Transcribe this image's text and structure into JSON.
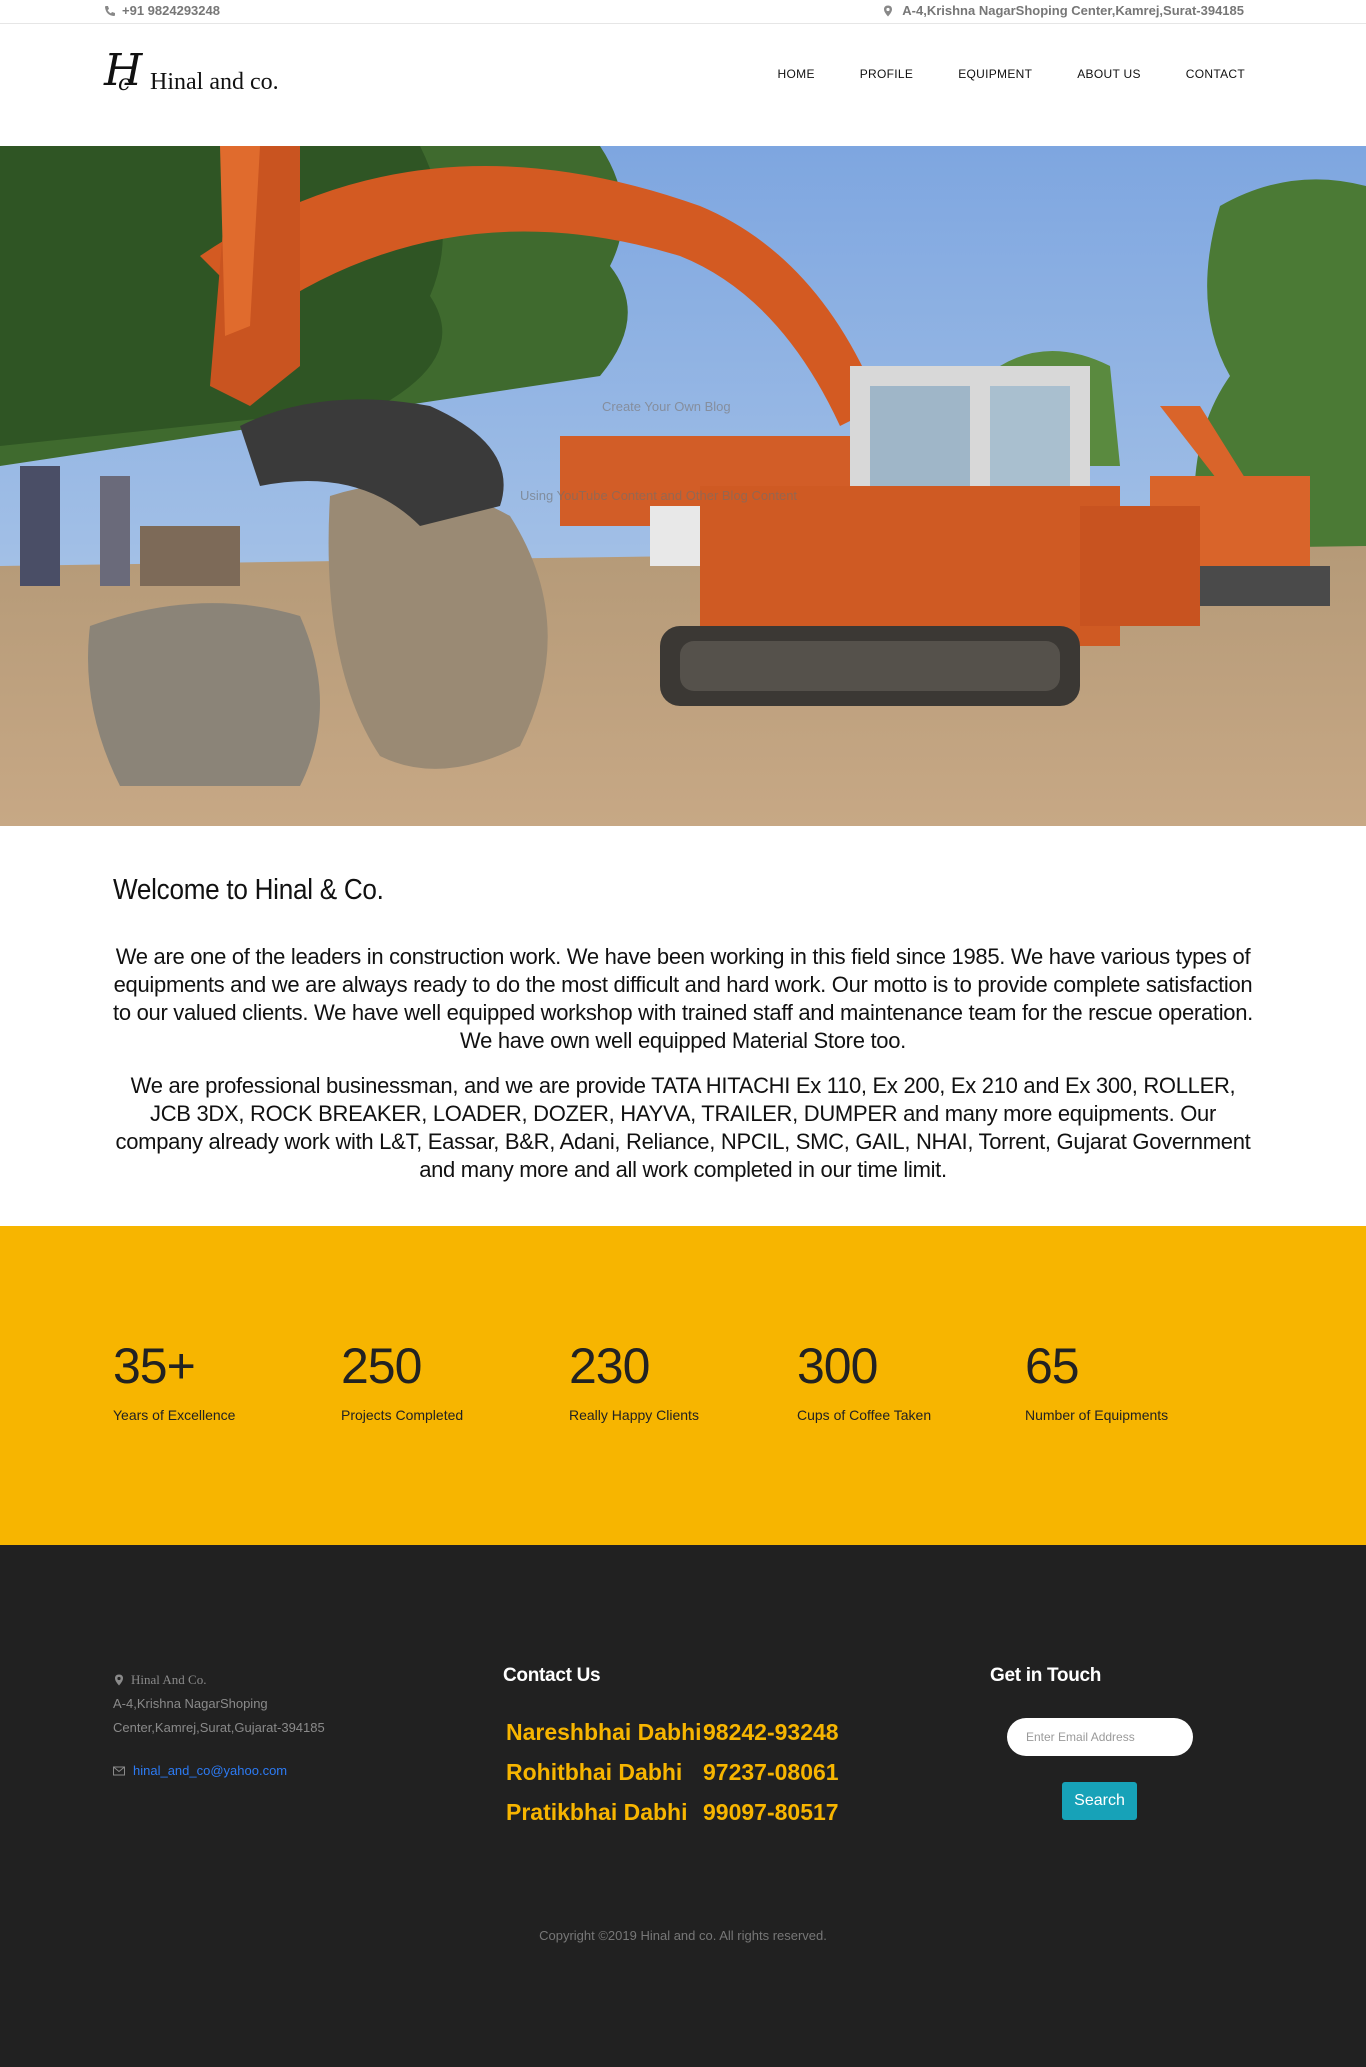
{
  "topbar": {
    "phone": "+91 9824293248",
    "address": "A-4,Krishna NagarShoping Center,Kamrej,Surat-394185"
  },
  "header": {
    "logo_monogram": "H",
    "logo_monogram_small": "c",
    "logo_text": "Hinal and co.",
    "nav": [
      "HOME",
      "PROFILE",
      "EQUIPMENT",
      "ABOUT US",
      "CONTACT"
    ]
  },
  "hero": {
    "overlay_line_1": "Create Your Own Blog",
    "overlay_line_2": "Using YouTube Content and Other Blog Content"
  },
  "welcome": {
    "title": "Welcome to Hinal & Co.",
    "paragraph_1": "We are one of the leaders in construction work. We have been working in this field since 1985. We have various types of equipments and we are always ready to do the most difficult and hard work. Our motto is to provide complete satisfaction to our valued clients. We have well equipped workshop with trained staff and maintenance team for the rescue operation. We have own well equipped Material Store too.",
    "paragraph_2": "We are professional businessman, and we are provide TATA HITACHI Ex 110, Ex 200, Ex 210 and Ex 300, ROLLER, JCB 3DX, ROCK BREAKER, LOADER, DOZER, HAYVA, TRAILER, DUMPER and many more equipments. Our company already work with L&T, Eassar, B&R, Adani, Reliance, NPCIL, SMC, GAIL, NHAI, Torrent, Gujarat Government and many more and all work completed in our time limit."
  },
  "stats": [
    {
      "value": "35+",
      "label": "Years of Excellence"
    },
    {
      "value": "250",
      "label": "Projects Completed"
    },
    {
      "value": "230",
      "label": "Really Happy Clients"
    },
    {
      "value": "300",
      "label": "Cups of Coffee Taken"
    },
    {
      "value": "65",
      "label": "Number of Equipments"
    }
  ],
  "footer": {
    "company": "Hinal And Co.",
    "address_line_1": "A-4,Krishna NagarShoping",
    "address_line_2": "Center,Kamrej,Surat,Gujarat-394185",
    "email": "hinal_and_co@yahoo.com",
    "contact_heading": "Contact Us",
    "contacts": [
      {
        "name": "Nareshbhai Dabhi",
        "phone": "98242-93248"
      },
      {
        "name": "Rohitbhai Dabhi",
        "phone": "97237-08061"
      },
      {
        "name": "Pratikbhai Dabhi",
        "phone": "99097-80517"
      }
    ],
    "get_in_touch_heading": "Get in Touch",
    "email_placeholder": "Enter Email Address",
    "search_label": "Search",
    "copyright": "Copyright ©2019 Hinal and co. All rights reserved."
  },
  "colors": {
    "accent_yellow": "#f7b500",
    "footer_bg": "#212121",
    "button_teal": "#17a2b8",
    "link_blue": "#2d7bf4"
  }
}
